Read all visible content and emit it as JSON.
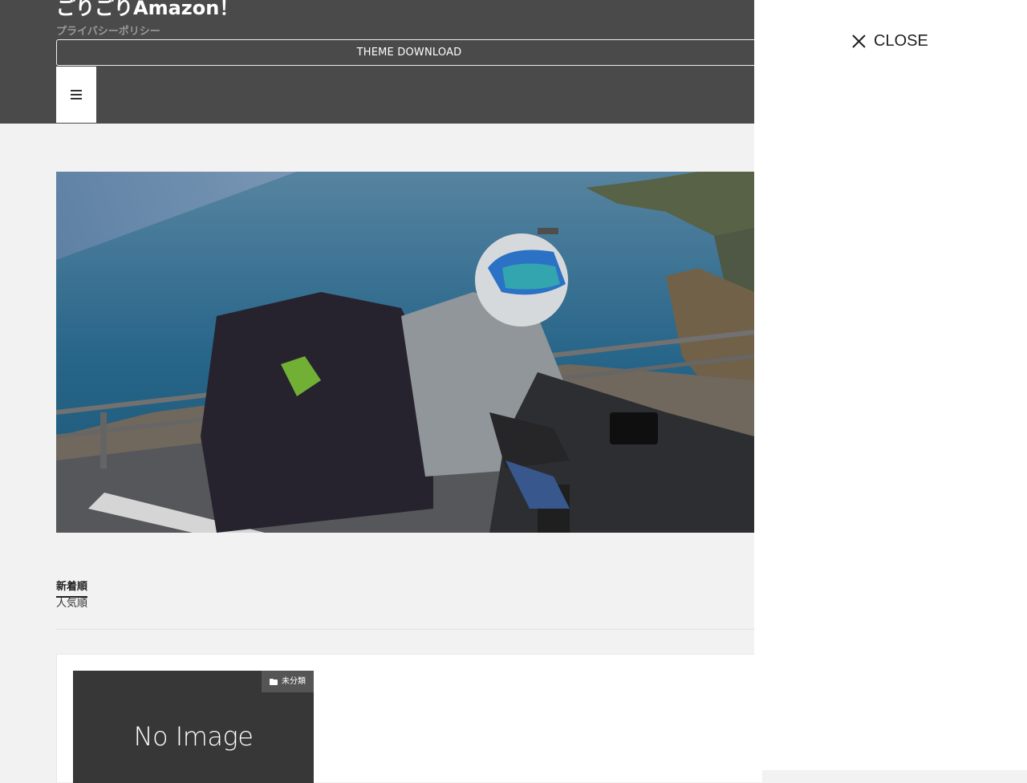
{
  "header": {
    "site_title": "ごりごりAmazon！",
    "site_description": "プライバシーポリシー",
    "theme_download_label": "THEME DOWNLOAD",
    "background_color": "#4a4a4a"
  },
  "menu_button": {
    "icon": "hamburger-menu-icon"
  },
  "hero": {
    "image": "motorcycle-rider-coast-photo"
  },
  "sort": {
    "newest_label": "新着順",
    "popular_label": "人気順",
    "active": "newest"
  },
  "posts": [
    {
      "thumbnail_text": "No Image",
      "category": "未分類",
      "category_icon": "folder-icon"
    }
  ],
  "drawer": {
    "close_label": "CLOSE",
    "close_icon": "close-icon"
  }
}
